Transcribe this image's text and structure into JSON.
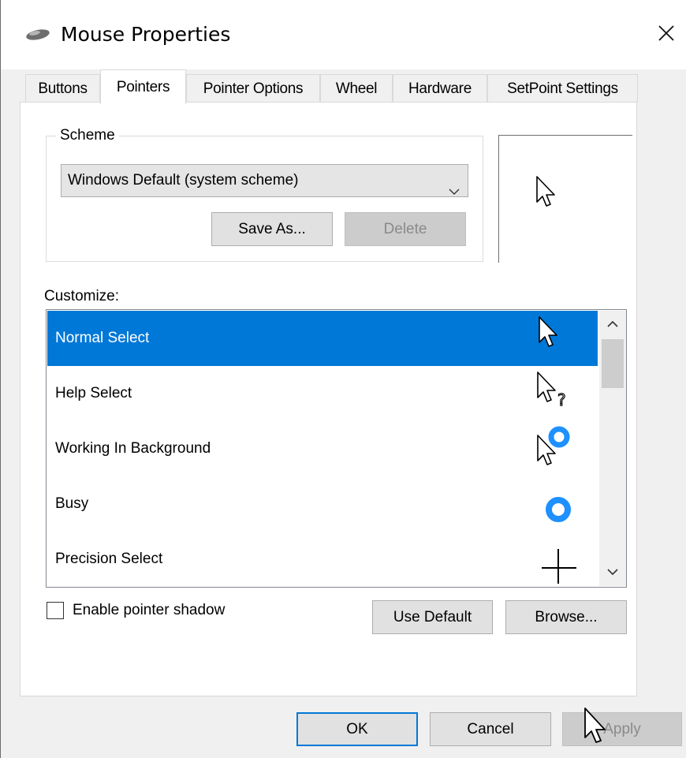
{
  "window": {
    "title": "Mouse Properties",
    "icon": "mouse-icon",
    "close_glyph": "✕"
  },
  "tabs": [
    {
      "label": "Buttons",
      "active": false
    },
    {
      "label": "Pointers",
      "active": true
    },
    {
      "label": "Pointer Options",
      "active": false
    },
    {
      "label": "Wheel",
      "active": false
    },
    {
      "label": "Hardware",
      "active": false
    },
    {
      "label": "SetPoint Settings",
      "active": false
    }
  ],
  "scheme": {
    "legend": "Scheme",
    "selected": "Windows Default (system scheme)",
    "save_as_label": "Save As...",
    "delete_label": "Delete"
  },
  "customize": {
    "label": "Customize:",
    "items": [
      {
        "label": "Normal Select",
        "icon": "arrow-cursor-icon",
        "selected": true
      },
      {
        "label": "Help Select",
        "icon": "help-cursor-icon",
        "selected": false
      },
      {
        "label": "Working In Background",
        "icon": "working-cursor-icon",
        "selected": false
      },
      {
        "label": "Busy",
        "icon": "busy-cursor-icon",
        "selected": false
      },
      {
        "label": "Precision Select",
        "icon": "crosshair-cursor-icon",
        "selected": false
      }
    ]
  },
  "shadow": {
    "label": "Enable pointer shadow",
    "checked": false
  },
  "buttons": {
    "use_default": "Use Default",
    "browse": "Browse...",
    "ok": "OK",
    "cancel": "Cancel",
    "apply": "Apply"
  },
  "colors": {
    "accent": "#0078d7",
    "busy_ring": "#1e90ff"
  }
}
